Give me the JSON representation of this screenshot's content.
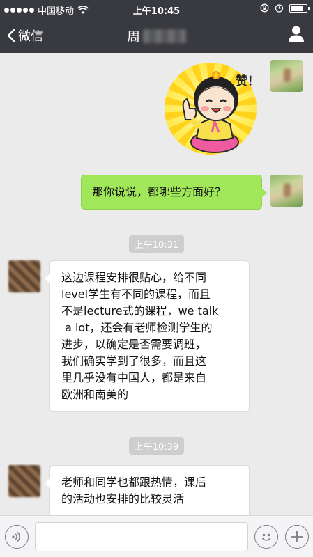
{
  "status_bar": {
    "carrier": "中国移动",
    "time": "上午10:45"
  },
  "nav": {
    "back_label": "微信",
    "title": "周"
  },
  "messages": [
    {
      "from": "me",
      "type": "sticker",
      "sticker_text": "赞！"
    },
    {
      "from": "me",
      "type": "text",
      "text": "那你说说，都哪些方面好？"
    },
    {
      "type": "timestamp",
      "text": "上午10:31"
    },
    {
      "from": "other",
      "type": "text",
      "lines": [
        "这边课程安排很贴心，给不同",
        "level学生有不同的课程，而且",
        "不是lecture式的课程，we talk",
        " a lot，还会有老师检测学生的",
        "进步，以确定是否需要调班，",
        "我们确实学到了很多，而且这",
        "里几乎没有中国人，都是来自",
        "欧洲和南美的"
      ]
    },
    {
      "type": "timestamp",
      "text": "上午10:39"
    },
    {
      "from": "other",
      "type": "text",
      "lines": [
        "老师和同学也都跟热情，课后",
        "的活动也安排的比较灵活"
      ]
    }
  ],
  "input_bar": {
    "voice_icon": "voice-icon",
    "emoji_icon": "emoji-icon",
    "plus_icon": "plus-icon",
    "input_value": ""
  }
}
